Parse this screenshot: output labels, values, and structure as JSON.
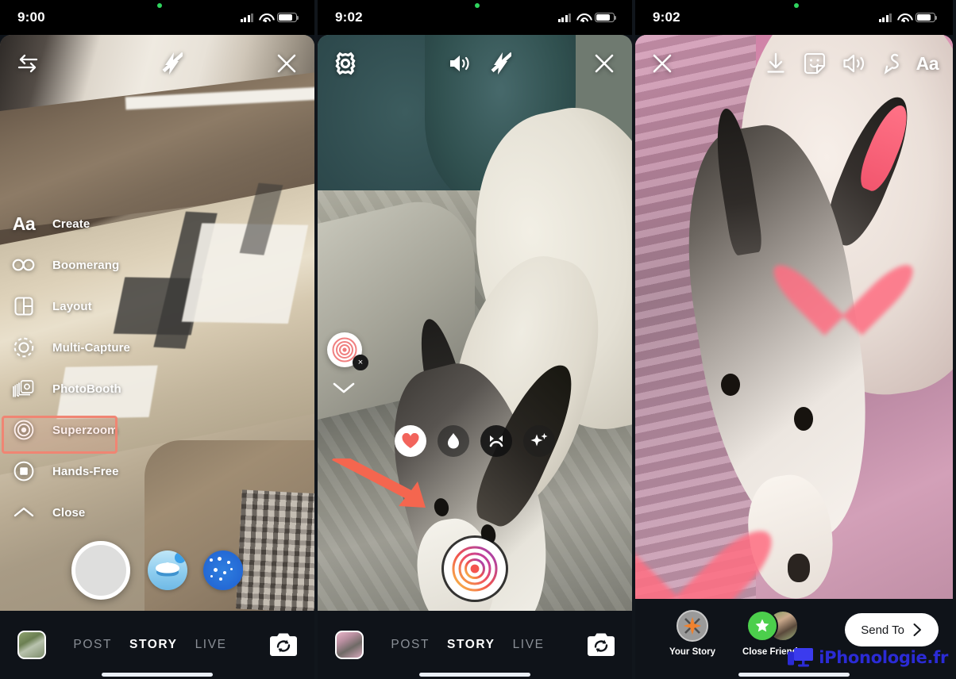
{
  "panels": [
    {
      "name": "camera-create-menu",
      "status": {
        "time": "9:00",
        "signal_icon": "cellular-signal-icon",
        "wifi_icon": "wifi-icon",
        "battery_icon": "battery-icon"
      },
      "topbar": [
        {
          "name": "swap-camera-icon",
          "label": ""
        },
        {
          "name": "flash-off-icon",
          "label": ""
        },
        {
          "name": "close-icon",
          "label": ""
        }
      ],
      "menu": [
        {
          "icon": "text-aa-icon",
          "label": "Create"
        },
        {
          "icon": "infinity-icon",
          "label": "Boomerang"
        },
        {
          "icon": "layout-grid-icon",
          "label": "Layout"
        },
        {
          "icon": "multi-capture-icon",
          "label": "Multi-Capture"
        },
        {
          "icon": "photobooth-cards-icon",
          "label": "PhotoBooth"
        },
        {
          "icon": "superzoom-target-icon",
          "label": "Superzoom"
        },
        {
          "icon": "hands-free-icon",
          "label": "Hands-Free"
        },
        {
          "icon": "chevron-up-icon",
          "label": "Close"
        }
      ],
      "highlighted_item": "Superzoom",
      "highlight_color": "#f08573",
      "effects": [
        {
          "name": "airplane-effect-bubble"
        },
        {
          "name": "sparkle-effect-bubble"
        }
      ],
      "nav": {
        "thumbnail": "gallery-thumbnail",
        "modes": [
          "POST",
          "STORY",
          "LIVE"
        ],
        "active_mode": "STORY",
        "flip_icon": "flip-camera-icon"
      }
    },
    {
      "name": "superzoom-capture",
      "status": {
        "time": "9:02",
        "signal_icon": "cellular-signal-icon",
        "wifi_icon": "wifi-icon",
        "battery_icon": "battery-icon"
      },
      "topbar": [
        {
          "name": "settings-gear-icon",
          "label": ""
        },
        {
          "name": "volume-on-icon",
          "label": ""
        },
        {
          "name": "flash-off-icon",
          "label": ""
        },
        {
          "name": "close-icon",
          "label": ""
        }
      ],
      "effect_badge": {
        "name": "superzoom-active-badge",
        "dismiss": "×"
      },
      "chevron": "chevron-down-icon",
      "effect_carousel": [
        {
          "name": "heart-effect",
          "selected": true
        },
        {
          "name": "flame-effect",
          "selected": false
        },
        {
          "name": "sad-face-effect",
          "selected": false
        },
        {
          "name": "sparkles-effect",
          "selected": false
        }
      ],
      "shutter": "superzoom-shutter-button",
      "pointer_arrow": "red-arrow-annotation",
      "nav": {
        "thumbnail": "gallery-thumbnail",
        "modes": [
          "POST",
          "STORY",
          "LIVE"
        ],
        "active_mode": "STORY",
        "flip_icon": "flip-camera-icon"
      }
    },
    {
      "name": "story-preview-share",
      "status": {
        "time": "9:02",
        "signal_icon": "cellular-signal-icon",
        "wifi_icon": "wifi-icon",
        "battery_icon": "battery-icon"
      },
      "topbar": [
        {
          "name": "close-icon",
          "label": ""
        },
        {
          "name": "download-icon",
          "label": ""
        },
        {
          "name": "sticker-icon",
          "label": ""
        },
        {
          "name": "volume-on-icon",
          "label": ""
        },
        {
          "name": "draw-squiggle-icon",
          "label": ""
        },
        {
          "name": "text-aa-icon",
          "label": "Aa"
        }
      ],
      "share": {
        "your_story": {
          "label": "Your Story",
          "icon": "your-story-avatar"
        },
        "close_friends": {
          "label": "Close Friends",
          "icon": "close-friends-avatar"
        },
        "send_to": {
          "label": "Send To",
          "icon": "chevron-right-icon"
        }
      }
    }
  ],
  "watermark": {
    "text": "iPhonologie.fr",
    "icon": "monitor-icon",
    "color": "#2b2bd6"
  }
}
